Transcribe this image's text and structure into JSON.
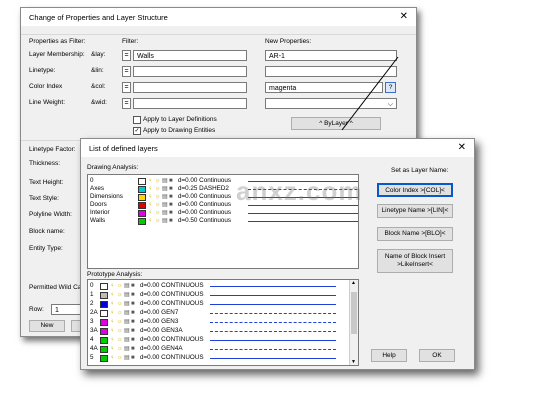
{
  "back": {
    "title": "Change of Properties and Layer Structure",
    "close": "✕",
    "section_filter": "Properties as Filter:",
    "section_filter2": "Filter:",
    "section_new": "New Properties:",
    "rows": [
      {
        "label": "Layer Membership:",
        "var": "&lay:",
        "op": "=",
        "filter": "Walls",
        "newval": "AR-1"
      },
      {
        "label": "Linetype:",
        "var": "&lin:",
        "op": "=",
        "filter": "",
        "newval": ""
      },
      {
        "label": "Color Index",
        "var": "&col:",
        "op": "=",
        "filter": "",
        "newval": "magenta",
        "btn": "?"
      },
      {
        "label": "Line Weight:",
        "var": "&wid:",
        "op": "=",
        "filter": "",
        "newval": "",
        "dropdown": "⌵"
      }
    ],
    "check1": "Apply to Layer Definitions",
    "check2": "Apply to Drawing Entities",
    "check2_mark": "✓",
    "bylayer": "^ ByLayer ^",
    "left_labels": [
      "Linetype Factor:",
      "Thickness:",
      "Text Height:",
      "Text Style:",
      "Polyline Width:",
      "Block name:",
      "Entity Type:",
      "Permitted Wild Car"
    ],
    "row_label": "Row:",
    "row_value": "1",
    "new_button": "New"
  },
  "front": {
    "title": "List of defined layers",
    "close": "✕",
    "drawing_label": "Drawing Analysis:",
    "drawing_rows": [
      {
        "name": "0",
        "color": "#ffffff",
        "desc": "d=0.00 Continuous"
      },
      {
        "name": "Axes",
        "color": "#00cccc",
        "desc": "d=0.25 DASHED2"
      },
      {
        "name": "Dimensions",
        "color": "#ffd800",
        "desc": "d=0.00 Continuous"
      },
      {
        "name": "Doors",
        "color": "#e00000",
        "desc": "d=0.00 Continuous"
      },
      {
        "name": "Interior",
        "color": "#e000e0",
        "desc": "d=0.00 Continuous"
      },
      {
        "name": "Walls",
        "color": "#00cc00",
        "desc": "d=0.50 Continuous"
      }
    ],
    "prototype_label": "Prototype Analysis:",
    "prototype_rows": [
      {
        "name": "0",
        "color": "#ffffff",
        "desc": "d=0.00 CONTINUOUS"
      },
      {
        "name": "1",
        "color": "#bbbbbb",
        "desc": "d=0.00 CONTINUOUS"
      },
      {
        "name": "2",
        "color": "#0000dd",
        "desc": "d=0.00 CONTINUOUS"
      },
      {
        "name": "2A",
        "color": "#ffffff",
        "desc": "d=0.00 GEN7"
      },
      {
        "name": "3",
        "color": "#e000e0",
        "desc": "d=0.00 GEN3"
      },
      {
        "name": "3A",
        "color": "#e000e0",
        "desc": "d=0.00 GEN3A"
      },
      {
        "name": "4",
        "color": "#00cc00",
        "desc": "d=0.00 CONTINUOUS"
      },
      {
        "name": "4A",
        "color": "#00cc00",
        "desc": "d=0.00 GEN4A"
      },
      {
        "name": "5",
        "color": "#00cc00",
        "desc": "d=0.00 CONTINUOUS"
      }
    ],
    "set_as_label": "Set as Layer Name:",
    "btn_color": "Color Index >[COL]<",
    "btn_linetype": "Linetype Name >[LIN]<",
    "btn_block": "Block Name >[BLO]<",
    "btn_insert": "Name of Block Insert >LikeInsert<",
    "help": "Help",
    "ok": "OK",
    "scroll_up": "▲",
    "scroll_down": "▼"
  },
  "watermark": "anxz.com"
}
